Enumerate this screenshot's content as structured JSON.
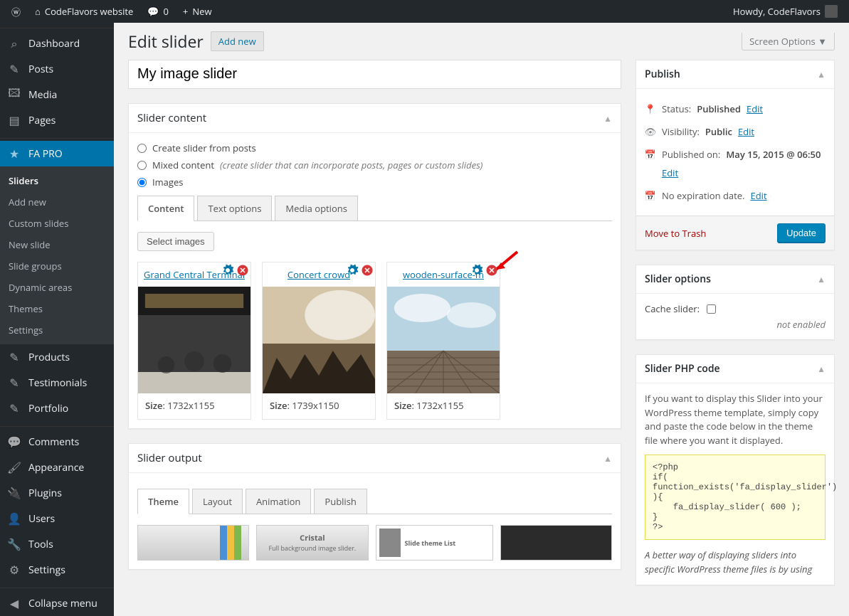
{
  "adminbar": {
    "site_name": "CodeFlavors website",
    "comments_count": "0",
    "new_label": "New",
    "howdy": "Howdy, CodeFlavors"
  },
  "sidebar": {
    "items": [
      {
        "icon": "⌕",
        "label": "Dashboard"
      },
      {
        "icon": "✎",
        "label": "Posts"
      },
      {
        "icon": "🖾",
        "label": "Media"
      },
      {
        "icon": "▤",
        "label": "Pages"
      },
      {
        "icon": "★",
        "label": "FA PRO",
        "current": true
      },
      {
        "icon": "✎",
        "label": "Products"
      },
      {
        "icon": "✎",
        "label": "Testimonials"
      },
      {
        "icon": "✎",
        "label": "Portfolio"
      },
      {
        "icon": "💬",
        "label": "Comments"
      },
      {
        "icon": "🖌",
        "label": "Appearance"
      },
      {
        "icon": "🔌",
        "label": "Plugins"
      },
      {
        "icon": "👤",
        "label": "Users"
      },
      {
        "icon": "🔧",
        "label": "Tools"
      },
      {
        "icon": "⚙",
        "label": "Settings"
      }
    ],
    "submenu": [
      "Sliders",
      "Add new",
      "Custom slides",
      "New slide",
      "Slide groups",
      "Dynamic areas",
      "Themes",
      "Settings"
    ],
    "collapse": "Collapse menu"
  },
  "header": {
    "title": "Edit slider",
    "add_new": "Add new",
    "screen_options": "Screen Options"
  },
  "title_input": "My image slider",
  "slider_content": {
    "heading": "Slider content",
    "radios": {
      "posts": "Create slider from posts",
      "mixed": "Mixed content",
      "mixed_note": "(create slider that can incorporate posts, pages or custom slides)",
      "images": "Images"
    },
    "tabs": [
      "Content",
      "Text options",
      "Media options"
    ],
    "select_images": "Select images",
    "images": [
      {
        "title": "Grand Central Terminal",
        "size_label": "Size",
        "size": "1732x1155"
      },
      {
        "title": "Concert crowd",
        "size_label": "Size",
        "size": "1739x1150"
      },
      {
        "title": "wooden-surface-m",
        "size_label": "Size",
        "size": "1732x1155"
      }
    ]
  },
  "slider_output": {
    "heading": "Slider output",
    "tabs": [
      "Theme",
      "Layout",
      "Animation",
      "Publish"
    ],
    "cristal": "Cristal",
    "cristal_sub": "Full background image slider.",
    "list_title": "Slide theme List"
  },
  "publish": {
    "heading": "Publish",
    "status_label": "Status:",
    "status_value": "Published",
    "visibility_label": "Visibility:",
    "visibility_value": "Public",
    "published_label": "Published on:",
    "published_value": "May 15, 2015 @ 06:50",
    "expiration": "No expiration date.",
    "edit": "Edit",
    "trash": "Move to Trash",
    "update": "Update"
  },
  "slider_options": {
    "heading": "Slider options",
    "cache_label": "Cache slider:",
    "not_enabled": "not enabled"
  },
  "php_code": {
    "heading": "Slider PHP code",
    "intro": "If you want to display this Slider into your WordPress theme template, simply copy and paste the code below in the theme file where you want it displayed.",
    "code": "<?php\nif( function_exists('fa_display_slider') ){\n    fa_display_slider( 600 );\n}\n?>",
    "outro": "A better way of displaying sliders into specific WordPress theme files is by using"
  }
}
